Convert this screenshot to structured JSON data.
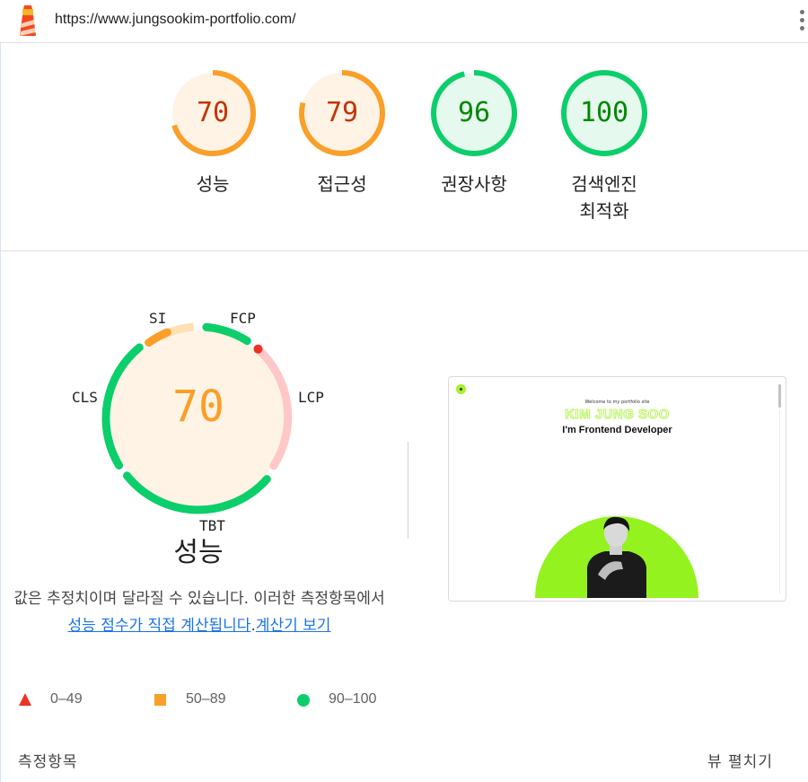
{
  "browser": {
    "url": "https://www.jungsookim-portfolio.com/"
  },
  "categories": [
    {
      "score": "70",
      "label": "성능",
      "score_fraction": 0.7,
      "ring": "#fa9f29",
      "fill": "#fff3e5",
      "text": "#c33300"
    },
    {
      "score": "79",
      "label": "접근성",
      "score_fraction": 0.79,
      "ring": "#fa9f29",
      "fill": "#fff3e5",
      "text": "#c33300"
    },
    {
      "score": "96",
      "label": "권장사항",
      "score_fraction": 0.96,
      "ring": "#0cce6b",
      "fill": "#e6f9ee",
      "text": "#008800"
    },
    {
      "score": "100",
      "label": "검색엔진\n최적화",
      "score_fraction": 1.0,
      "ring": "#0cce6b",
      "fill": "#e6f9ee",
      "text": "#008800"
    }
  ],
  "performance": {
    "score": "70",
    "title": "성능",
    "metrics": {
      "si": "SI",
      "fcp": "FCP",
      "lcp": "LCP",
      "tbt": "TBT",
      "cls": "CLS"
    },
    "description_prefix": "값은 추정치이며 달라질 수 있습니다. 이러한 측정항목에서 ",
    "description_link": "성능 점수가 직접 계산됩니다",
    "description_mid": ".",
    "calculator_link": "계산기 보기"
  },
  "screenshot": {
    "welcome": "Welcome to my portfolio site",
    "name": "KIM JUNG SOO",
    "role": "I'm Frontend Developer"
  },
  "legend": {
    "fail": "0–49",
    "average": "50–89",
    "pass": "90–100"
  },
  "footer": {
    "metrics_label": "측정항목",
    "expand_label": "뷰 펼치기"
  },
  "colors": {
    "fail": "#eb3323",
    "average": "#fa9f29",
    "pass": "#0cce6b",
    "link": "#1a73e8"
  }
}
